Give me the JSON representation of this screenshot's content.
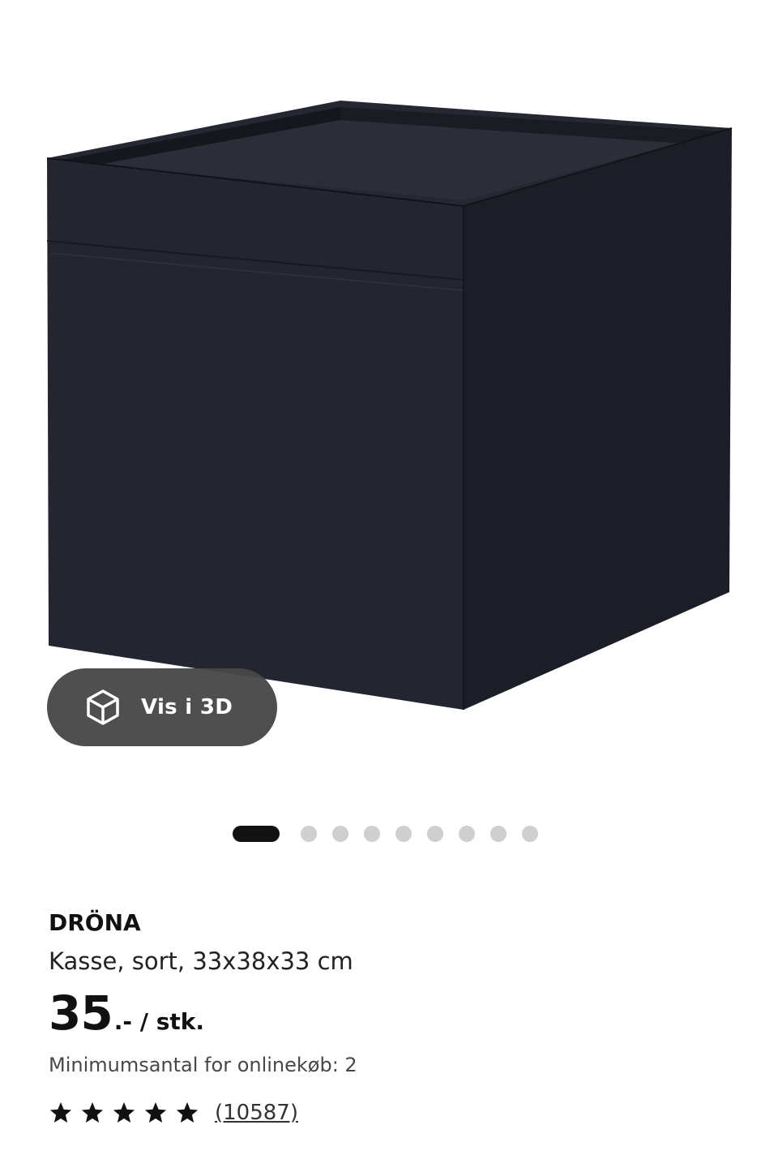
{
  "product": {
    "image_alt": "DRÖNA",
    "view_3d_label": "Vis i 3D",
    "name": "DRÖNA",
    "description": "Kasse, sort, 33x38x33 cm",
    "price": "35",
    "price_suffix": ".- / stk.",
    "min_qty_text": "Minimumsantal for onlinekøb: 2",
    "rating": 5,
    "rating_max": 5,
    "review_count_text": "(10587)"
  },
  "carousel": {
    "total": 9,
    "active_index": 0
  },
  "colors": {
    "box": "#1f222b",
    "accent": "#111111",
    "dot_inactive": "#cfcfcf",
    "button_bg": "#484848"
  },
  "icons": {
    "view_3d": "cube-icon",
    "rating": "star-icon"
  }
}
